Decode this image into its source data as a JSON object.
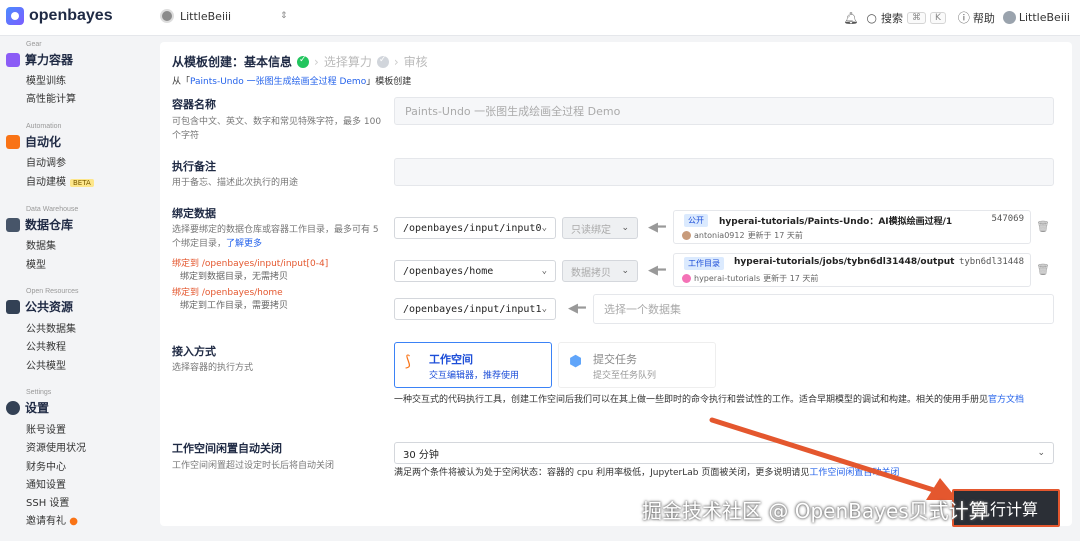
{
  "app": {
    "logo_text": "openbayes"
  },
  "topbar": {
    "workspace_name": "LittleBeiii",
    "search_label": "搜索",
    "kbd_cmd": "⌘",
    "kbd_k": "K",
    "help_label": "帮助",
    "user_name": "LittleBeiii"
  },
  "sidebar": {
    "gear": {
      "caption": "Gear",
      "title": "算力容器",
      "items": [
        "模型训练",
        "高性能计算"
      ]
    },
    "automation": {
      "caption": "Automation",
      "title": "自动化",
      "items": [
        "自动调参",
        "自动建模"
      ],
      "beta": "BETA"
    },
    "data": {
      "caption": "Data Warehouse",
      "title": "数据仓库",
      "items": [
        "数据集",
        "模型"
      ]
    },
    "open": {
      "caption": "Open Resources",
      "title": "公共资源",
      "items": [
        "公共数据集",
        "公共教程",
        "公共模型"
      ]
    },
    "settings": {
      "caption": "Settings",
      "title": "设置",
      "items": [
        "账号设置",
        "资源使用状况",
        "财务中心",
        "通知设置",
        "SSH 设置",
        "邀请有礼"
      ]
    }
  },
  "steps": {
    "step1": "从模板创建：基本信息",
    "step2": "选择算力",
    "step3": "审核"
  },
  "from_line": {
    "prefix": "从「",
    "link": "Paints-Undo 一张图生成绘画全过程 Demo",
    "suffix": "」模板创建"
  },
  "container_name": {
    "label": "容器名称",
    "hint": "可包含中文、英文、数字和常见特殊字符，最多 100 个字符",
    "placeholder": "Paints-Undo 一张图生成绘画全过程 Demo"
  },
  "exec_note": {
    "label": "执行备注",
    "hint": "用于备忘、描述此次执行的用途"
  },
  "bind": {
    "label": "绑定数据",
    "hint": "选择要绑定的数据仓库或容器工作目录，最多可有 5 个绑定目录，",
    "hint_link": "了解更多",
    "note1_red": "绑定到 /openbayes/input/input[0-4]",
    "note1_grey": "绑定到数据目录，无需拷贝",
    "note2_red": "绑定到 /openbayes/home",
    "note2_grey": "绑定到工作目录，需要拷贝",
    "rows": [
      {
        "path": "/openbayes/input/input0",
        "mode": "只读绑定",
        "badge": "公开",
        "name": "hyperai-tutorials/Paints-Undo：AI模拟绘画过程/1",
        "id": "547069",
        "owner": "antonia0912",
        "updated": "更新于 17 天前"
      },
      {
        "path": "/openbayes/home",
        "mode": "数据拷贝",
        "badge": "工作目录",
        "name": "hyperai-tutorials/jobs/tybn6dl31448/output",
        "id": "tybn6dl31448",
        "owner": "hyperai-tutorials",
        "updated": "更新于 17 天前"
      },
      {
        "path": "/openbayes/input/input1",
        "placeholder": "选择一个数据集"
      }
    ]
  },
  "access": {
    "label": "接入方式",
    "hint": "选择容器的执行方式",
    "workspace_title": "工作空间",
    "workspace_sub": "交互编辑器，推荐使用",
    "task_title": "提交任务",
    "task_sub": "提交至任务队列",
    "desc": "一种交互式的代码执行工具，创建工作空间后我们可以在其上做一些即时的命令执行和尝试性的工作。适合早期模型的调试和构建。相关的使用手册见",
    "desc_link": "官方文档"
  },
  "idle": {
    "label": "工作空间闲置自动关闭",
    "hint": "工作空间闲置超过设定时长后将自动关闭",
    "value": "30 分钟",
    "note": "满足两个条件将被认为处于空闲状态：容器的 cpu 利用率极低，JupyterLab 页面被关闭，更多说明请见",
    "note_link": "工作空间闲置自动关闭"
  },
  "footer": {
    "submit": "执行计算",
    "watermark": "掘金技术社区 @ OpenBayes贝式计算"
  },
  "colors": {
    "accent": "#3b82f6",
    "danger": "#e4572e",
    "success": "#22c55e"
  }
}
